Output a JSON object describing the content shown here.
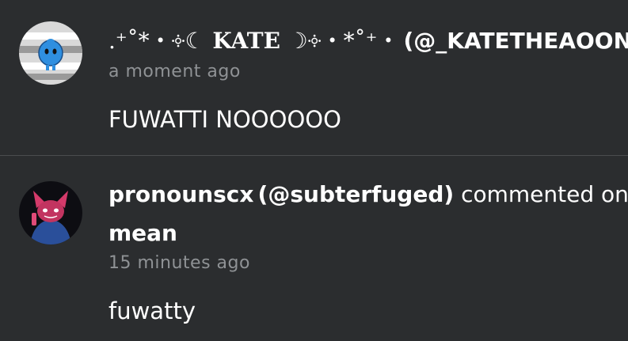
{
  "comments": [
    {
      "author_prefix": ".⁺˚*・༓☾",
      "author_name": " KATE ",
      "author_suffix": "☽༓・*˚⁺‧",
      "handle": "(@_KATETHEAOONI",
      "timestamp": "a moment ago",
      "body": "FUWATTI NOOOOOO"
    },
    {
      "author": "pronounscx",
      "handle": "(@subterfuged)",
      "action": " commented on",
      "post_title": "mean",
      "timestamp": "15 minutes ago",
      "body": "fuwatty"
    }
  ],
  "colors": {
    "background": "#2b2d2f",
    "text": "#ffffff",
    "timestamp": "#8f9295",
    "divider": "#4b4d4f"
  }
}
